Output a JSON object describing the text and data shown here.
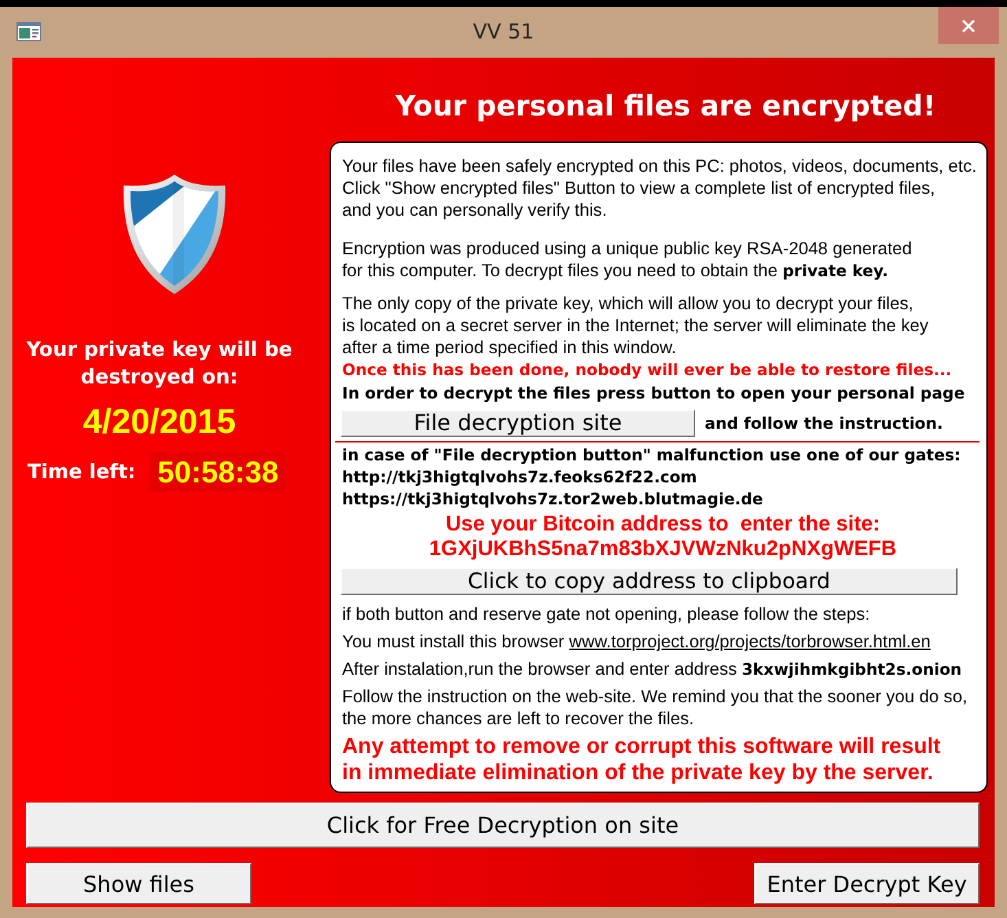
{
  "window": {
    "title": "VV 51"
  },
  "header": {
    "title": "Your personal files are encrypted!"
  },
  "countdown": {
    "message": "Your private key will be destroyed on:",
    "date": "4/20/2015",
    "time_label": "Time left:",
    "time_left": "50:58:38"
  },
  "message_items": [
    {
      "kind": "text",
      "text": "Your files have been safely encrypted on this PC: photos, videos, documents, etc.\nClick \"Show encrypted files\" Button to view a complete list of encrypted files,\nand you can personally verify this."
    },
    {
      "kind": "text",
      "text": "Encryption was produced using a unique public key RSA-2048 generated\nfor this computer. To decrypt files you need to obtain the **private key.**"
    },
    {
      "kind": "text",
      "text": "The only copy of the private key, which will allow you to decrypt your files,\nis located on a secret server in the Internet; the server will eliminate the key\nafter a time period specified in this window."
    },
    {
      "kind": "alert",
      "warning": "Once this has been done, nobody will ever be able to restore files..."
    },
    {
      "kind": "strong",
      "instruction": "In order to decrypt the files press button to open your personal page"
    },
    {
      "kind": "action",
      "button": "File decryption site",
      "note": "and follow the instruction."
    },
    {
      "kind": "divider"
    },
    {
      "kind": "strong",
      "instruction": "in case of \"File decryption button\" malfunction use one of our gates:"
    },
    {
      "kind": "strong",
      "instruction": "http://tkj3higtqlvohs7z.feoks62f22.com"
    },
    {
      "kind": "strong",
      "instruction": "https://tkj3higtqlvohs7z.tor2web.blutmagie.de"
    },
    {
      "kind": "address",
      "label": "Use your Bitcoin address to  enter the site:",
      "address": "1GXjUKBhS5na7m83bXJVWzNku2pNXgWEFB"
    },
    {
      "kind": "button",
      "button": "Click to copy address to clipboard"
    },
    {
      "kind": "text",
      "text": "if both button and reserve gate not opening, please follow the steps:"
    },
    {
      "kind": "link",
      "text": "You must install this browser",
      "link": "www.torproject.org/projects/torbrowser.html.en"
    },
    {
      "kind": "text",
      "text": "After instalation,run the browser and enter address **3kxwjihmkgibht2s.onion**"
    },
    {
      "kind": "text",
      "text": "Follow the instruction on the web-site. We remind you that the sooner you do so,\nthe more chances are left to recover the files."
    },
    {
      "kind": "banner",
      "warning": "Any attempt to remove or corrupt this software will result\nin immediate elimination of the private key by the server."
    }
  ],
  "buttons": {
    "free_decryption": "Click for Free Decryption on site",
    "show_files": "Show files",
    "enter_key": "Enter Decrypt Key"
  }
}
